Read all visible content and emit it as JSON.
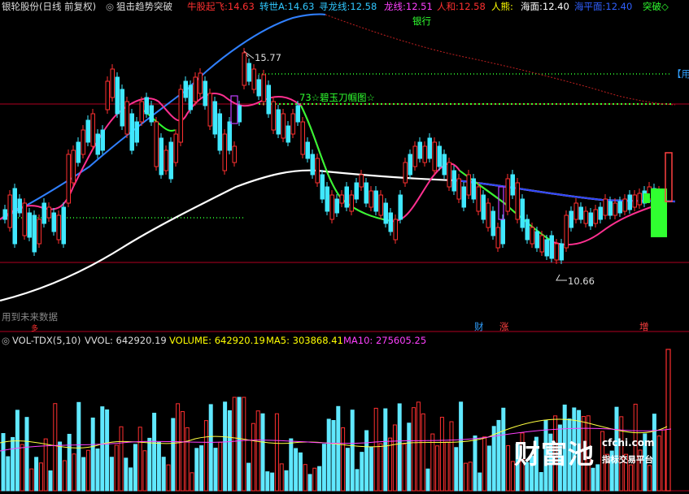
{
  "window": {
    "stock_title": "银轮股份(日线 前复权)",
    "indicator_name": "狙击趋势突破"
  },
  "header_indicators": [
    {
      "label": "牛股起飞:",
      "value": "14.63",
      "color": "#ff3030"
    },
    {
      "label": "转世A:",
      "value": "14.63",
      "color": "#30c8ff"
    },
    {
      "label": "寻龙线:",
      "value": "12.58",
      "color": "#30c8ff"
    },
    {
      "label": "龙线:",
      "value": "12.51",
      "color": "#ff40ff"
    },
    {
      "label": "人和:",
      "value": "12.58",
      "color": "#ff3030"
    },
    {
      "label": "人熊:",
      "value": "",
      "color": "#ffff00"
    },
    {
      "label": "海面:",
      "value": "12.40",
      "color": "#ffffff"
    },
    {
      "label": "海平面:",
      "value": "12.40",
      "color": "#3060ff"
    },
    {
      "label": "突破",
      "value": "◇",
      "color": "#30ff30"
    }
  ],
  "main_annotations": {
    "sector_label": "银行",
    "high_price": "15.77",
    "low_price": "10.66",
    "pattern_label": "73☆碧玉刀帼图☆",
    "right_marker": "【用",
    "future_data_hint": "用到未来数据",
    "event_markers": [
      "财",
      "涨",
      "增"
    ],
    "left_marker": "多"
  },
  "volume_panel": {
    "indicator": "VOL-TDX(5,10)",
    "vvol_label": "VVOL:",
    "vvol_value": "642920.19",
    "volume_label": "VOLUME:",
    "volume_value": "642920.19",
    "ma5_label": "MA5:",
    "ma5_value": "303868.41",
    "ma10_label": "MA10:",
    "ma10_value": "275605.25"
  },
  "watermark": {
    "brand": "财富池",
    "domain": "cfchi.com",
    "tagline": "指标交易平台"
  },
  "colors": {
    "up": "#ff3030",
    "down": "#40e8ff",
    "ma_blue": "#3080ff",
    "ma_white": "#ffffff",
    "ma_pink": "#ff3090",
    "ma_green": "#30ff30",
    "grid_red": "#b00020"
  }
}
